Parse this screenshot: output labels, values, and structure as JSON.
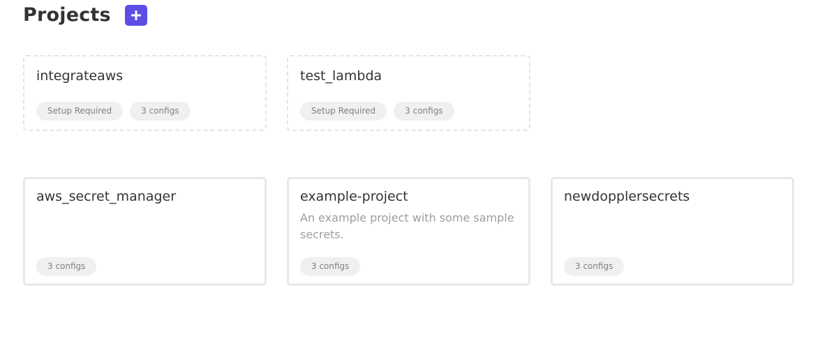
{
  "page": {
    "title": "Projects",
    "add_icon": "plus-icon",
    "accent_color": "#5c4ee5"
  },
  "projects": [
    {
      "name": "integrateaws",
      "description": "",
      "badges": [
        "Setup Required",
        "3 configs"
      ],
      "state": "setup-required"
    },
    {
      "name": "test_lambda",
      "description": "",
      "badges": [
        "Setup Required",
        "3 configs"
      ],
      "state": "setup-required"
    },
    {
      "name": "aws_secret_manager",
      "description": "",
      "badges": [
        "3 configs"
      ],
      "state": "configured"
    },
    {
      "name": "example-project",
      "description": "An example project with some sample secrets.",
      "badges": [
        "3 configs"
      ],
      "state": "configured"
    },
    {
      "name": "newdopplersecrets",
      "description": "",
      "badges": [
        "3 configs"
      ],
      "state": "configured"
    }
  ]
}
